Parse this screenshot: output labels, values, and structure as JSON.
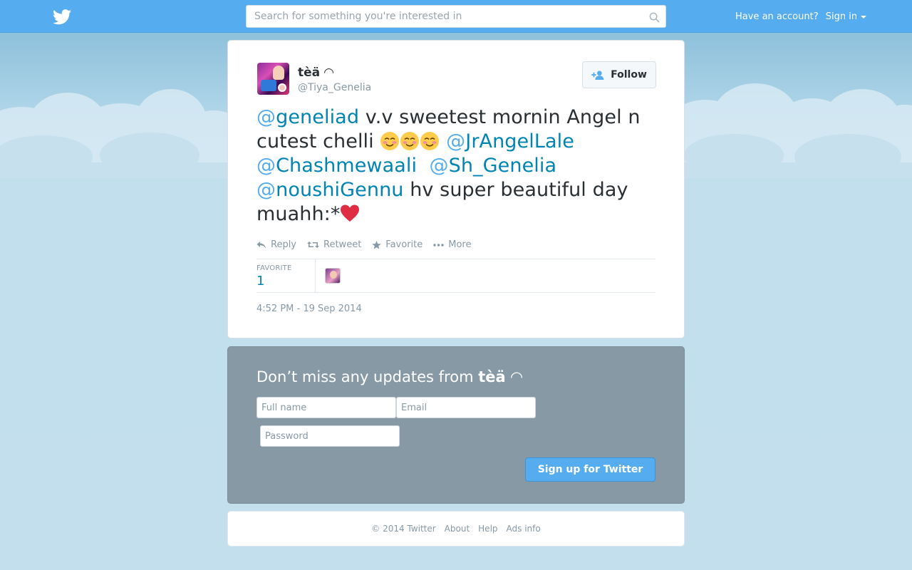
{
  "colors": {
    "brand": "#55acee",
    "link": "#0084b4",
    "muted": "#8899a6",
    "signup_bg": "#8899a6"
  },
  "topbar": {
    "logo_icon": "twitter-bird-icon",
    "search_placeholder": "Search for something you're interested in",
    "search_icon": "search-icon",
    "have_account": "Have an account?",
    "sign_in": "Sign in"
  },
  "tweet": {
    "author_name": "tèä ◠",
    "author_handle": "@Tiya_Genelia",
    "follow_label": "Follow",
    "text_parts": {
      "m1": "geneliad",
      "t1": " v.v sweetest mornin Angel n cutest chelli ",
      "m2": "JrAngelLale",
      "m3": "Chashmewaali",
      "m4": "Sh_Genelia",
      "m5": "noushiGennu",
      "t2": " hv super beautiful day muahh:*",
      "at": "@"
    },
    "emojis": [
      "smiling-face-icon",
      "smiling-face-icon",
      "smiling-face-icon",
      "red-heart-icon"
    ],
    "actions": {
      "reply": "Reply",
      "retweet": "Retweet",
      "favorite": "Favorite",
      "more": "More"
    },
    "stats": {
      "favorite_label": "FAVORITE",
      "favorite_count": "1"
    },
    "timestamp": "4:52 PM - 19 Sep 2014"
  },
  "signup": {
    "title_prefix": "Don’t miss any updates from",
    "title_name": "tèä ◠",
    "full_name_placeholder": "Full name",
    "email_placeholder": "Email",
    "password_placeholder": "Password",
    "button_label": "Sign up for Twitter"
  },
  "footer": {
    "copyright": "© 2014 Twitter",
    "about": "About",
    "help": "Help",
    "ads_info": "Ads info"
  }
}
